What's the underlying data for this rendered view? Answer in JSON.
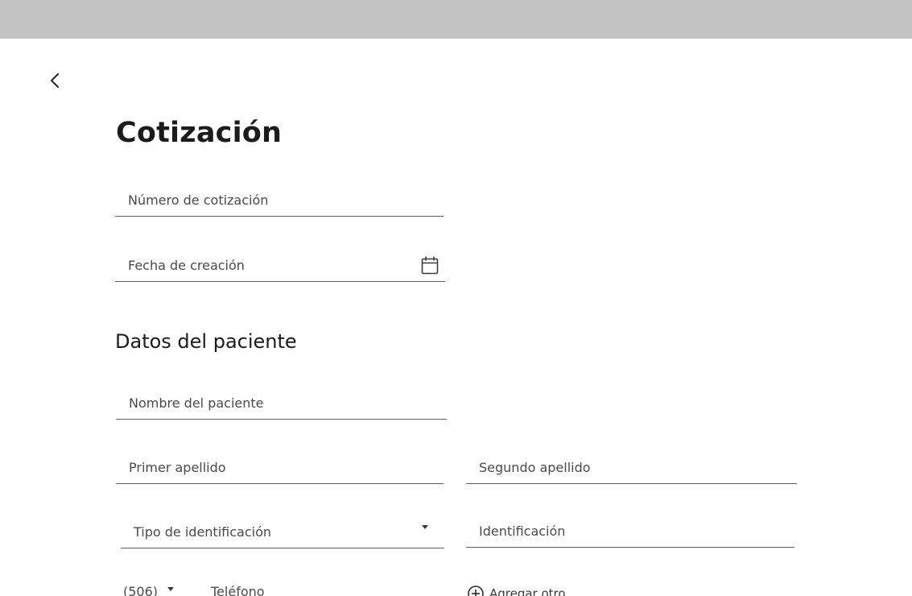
{
  "page": {
    "title": "Cotización",
    "back_icon": "chevron-left-icon"
  },
  "quote": {
    "number_label": "Número de cotización",
    "creation_date_label": "Fecha de creación",
    "calendar_icon": "calendar-icon"
  },
  "patient": {
    "section_title": "Datos del paciente",
    "name_label": "Nombre del paciente",
    "first_lastname_label": "Primer apellido",
    "second_lastname_label": "Segundo apellido",
    "id_type_label": "Tipo de identificación",
    "id_label": "Identificación",
    "phone_prefix": "(506)",
    "phone_label": "Teléfono",
    "add_other_label": "Agregar otro"
  },
  "colors": {
    "topbar": "#c4c4c4",
    "underline": "#5c5c5c",
    "label": "#4a4a4a",
    "title": "#1b1b1b"
  }
}
